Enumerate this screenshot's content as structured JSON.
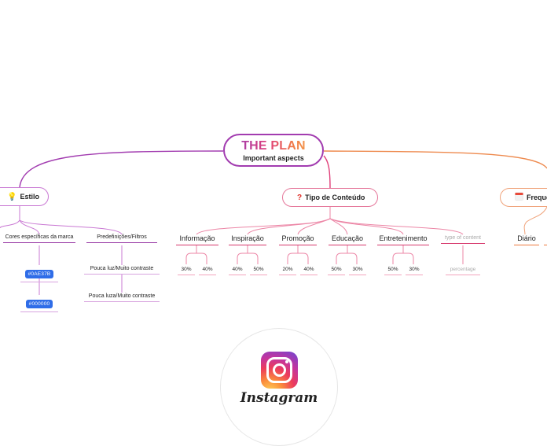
{
  "central": {
    "title": "THE PLAN",
    "subtitle": "Important aspects"
  },
  "colors": {
    "estilo_branch": "#a23cb0",
    "tipo_branch": "#e0407a",
    "freq_branch": "#f0a050",
    "tag_blue": "#2f6de8"
  },
  "topics": {
    "estilo": {
      "icon": "lightbulb-icon",
      "icon_glyph": "💡",
      "label": "Estilo",
      "children": [
        {
          "label": "Cores específicas da marca",
          "children": [
            "#0AE37B",
            "#000000"
          ]
        },
        {
          "label": "Predefinições/Filtros",
          "children": [
            "Pouca luz/Muito contraste",
            "Pouca luza/Muito contraste"
          ]
        }
      ]
    },
    "tipo": {
      "icon": "question-mark-icon",
      "icon_glyph": "❓",
      "label": "Tipo de Conteúdo",
      "children": [
        {
          "label": "Informação",
          "values": [
            "30%",
            "40%"
          ]
        },
        {
          "label": "Inspiração",
          "values": [
            "40%",
            "50%"
          ]
        },
        {
          "label": "Promoção",
          "values": [
            "20%",
            "40%"
          ]
        },
        {
          "label": "Educação",
          "values": [
            "50%",
            "30%"
          ]
        },
        {
          "label": "Entretenimento",
          "values": [
            "50%",
            "30%"
          ]
        },
        {
          "label": "type of content",
          "values": [
            "percentage"
          ],
          "placeholder": true
        }
      ]
    },
    "frequencia": {
      "icon": "calendar-icon",
      "icon_glyph": "📅",
      "label": "Frequê",
      "children": [
        {
          "label": "Diário"
        }
      ]
    }
  },
  "instagram": {
    "logo": "instagram-logo-icon",
    "wordmark": "Instagram"
  }
}
